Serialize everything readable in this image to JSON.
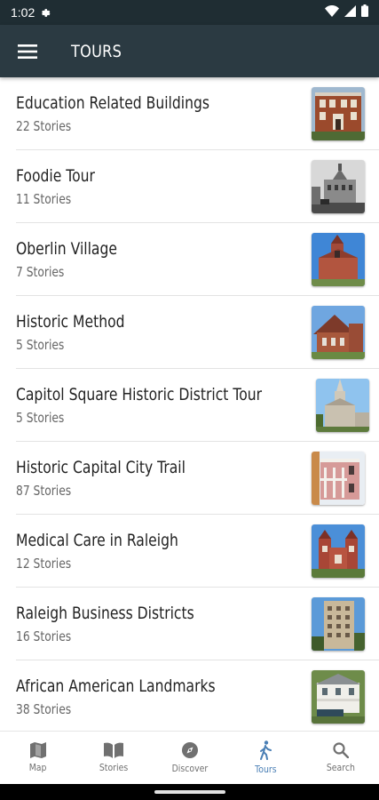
{
  "status_bar": {
    "time": "1:02"
  },
  "app_bar": {
    "title": "TOURS"
  },
  "tours": [
    {
      "title": "Education Related Buildings",
      "stories": "22 Stories",
      "thumb": "brick-school"
    },
    {
      "title": "Foodie Tour",
      "stories": "11 Stories",
      "thumb": "bw-building"
    },
    {
      "title": "Oberlin Village",
      "stories": "7 Stories",
      "thumb": "brick-church-sky"
    },
    {
      "title": "Historic Method",
      "stories": "5 Stories",
      "thumb": "brick-church"
    },
    {
      "title": "Capitol Square Historic District Tour",
      "stories": "5 Stories",
      "thumb": "steeple"
    },
    {
      "title": "Historic Capital City Trail",
      "stories": "87 Stories",
      "thumb": "pink-mansion"
    },
    {
      "title": "Medical Care in Raleigh",
      "stories": "12 Stories",
      "thumb": "red-towers"
    },
    {
      "title": "Raleigh Business Districts",
      "stories": "16 Stories",
      "thumb": "office-tower"
    },
    {
      "title": "African American Landmarks",
      "stories": "38 Stories",
      "thumb": "white-house"
    }
  ],
  "bottom_nav": [
    {
      "label": "Map",
      "icon": "map-icon"
    },
    {
      "label": "Stories",
      "icon": "book-icon"
    },
    {
      "label": "Discover",
      "icon": "compass-icon"
    },
    {
      "label": "Tours",
      "icon": "walking-icon",
      "active": true
    },
    {
      "label": "Search",
      "icon": "search-icon"
    }
  ],
  "colors": {
    "app_bar": "#2b3a42",
    "status_bar": "#1f2d33",
    "active_tab": "#4a7fb5"
  }
}
